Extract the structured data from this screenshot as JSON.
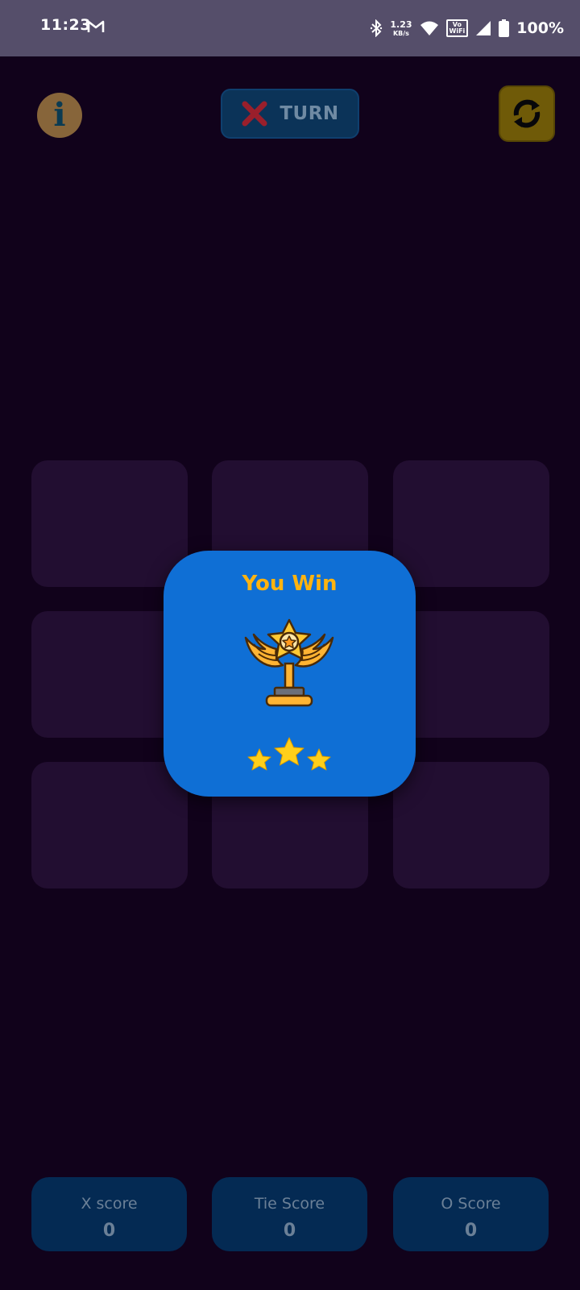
{
  "status_bar": {
    "time": "11:23",
    "speed_value": "1.23",
    "speed_unit": "KB/s",
    "vowifi_top": "Vo",
    "vowifi_bottom": "WiFi",
    "battery": "100%"
  },
  "header": {
    "info_glyph": "i",
    "turn_label": "TURN",
    "turn_player": "X",
    "colors": {
      "info": "#87653a",
      "turn_bg": "#0b3358",
      "restart": "#6f5a08",
      "x_mark": "#9a1f2b"
    }
  },
  "board": {
    "cells": [
      "",
      "",
      "",
      "",
      "",
      "",
      "",
      "",
      ""
    ]
  },
  "result_dialog": {
    "title": "You Win",
    "stars": 3,
    "icon": "winged-star-trophy-icon",
    "colors": {
      "bg": "#0f6fd5",
      "title": "#ffb30f",
      "star": "#ffcf1a"
    }
  },
  "scores": [
    {
      "label": "X score",
      "value": "0"
    },
    {
      "label": "Tie Score",
      "value": "0"
    },
    {
      "label": "O Score",
      "value": "0"
    }
  ]
}
